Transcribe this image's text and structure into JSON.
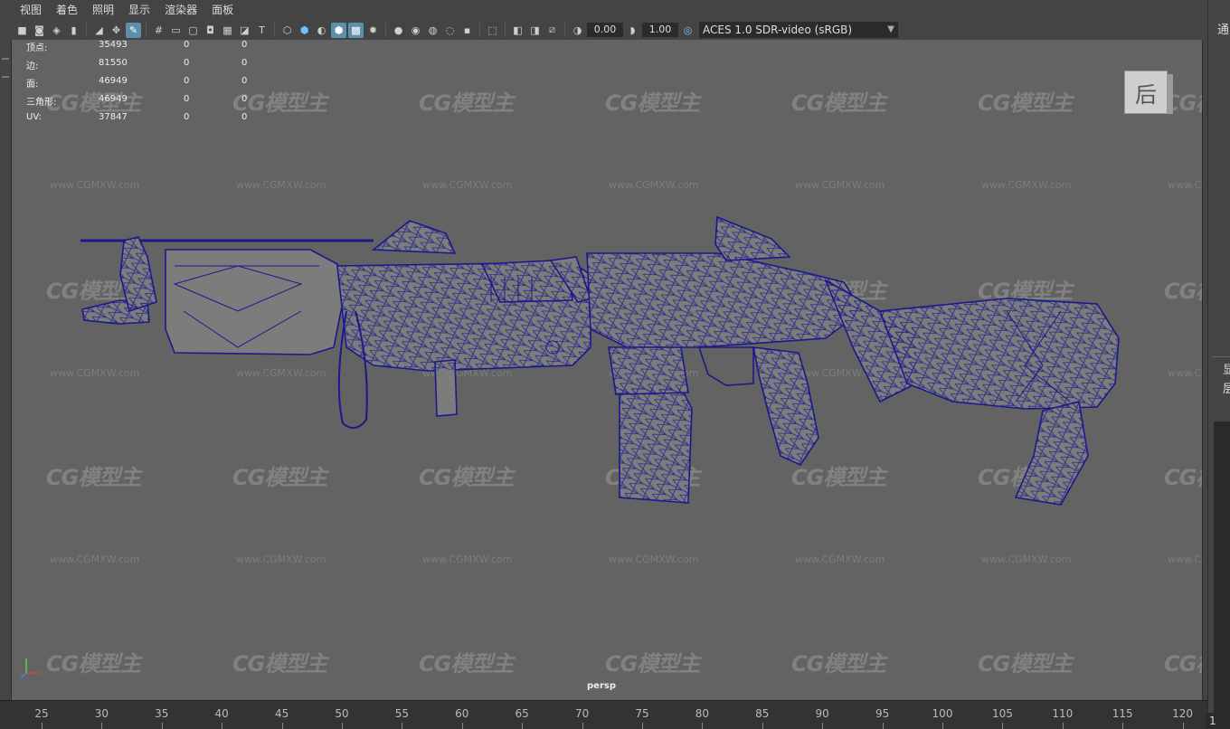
{
  "menubar": {
    "items": [
      "视图",
      "着色",
      "照明",
      "显示",
      "渲染器",
      "面板"
    ]
  },
  "toolbar": {
    "exposure_value": "0.00",
    "gamma_value": "1.00",
    "color_space": "ACES 1.0 SDR-video (sRGB)",
    "icons": [
      "camera-icon",
      "camera-attributes-icon",
      "bookmark-icon",
      "bookmark-flag-icon",
      "image-plane-icon",
      "2d-pan-icon",
      "grease-pencil-icon",
      "grid-icon",
      "film-gate-icon",
      "resolution-gate-icon",
      "gate-mask-icon",
      "field-chart-icon",
      "safe-action-icon",
      "safe-title-icon",
      "wireframe-icon",
      "smooth-shade-icon",
      "default-material-icon",
      "wireframe-on-shaded-icon",
      "textured-icon",
      "lights-icon",
      "shadows-icon",
      "screen-space-ao-icon",
      "motion-blur-icon",
      "anti-aliasing-icon",
      "depth-of-field-icon",
      "isolate-select-icon",
      "xray-icon",
      "xray-joints-icon",
      "xray-components-icon",
      "exposure-icon",
      "gamma-icon",
      "color-management-icon"
    ]
  },
  "hud": {
    "rows": [
      {
        "label": "顶点:",
        "v1": "35493",
        "v2": "0",
        "v3": "0"
      },
      {
        "label": "边:",
        "v1": "81550",
        "v2": "0",
        "v3": "0"
      },
      {
        "label": "面:",
        "v1": "46949",
        "v2": "0",
        "v3": "0"
      },
      {
        "label": "三角形:",
        "v1": "46949",
        "v2": "0",
        "v3": "0"
      },
      {
        "label": "UV:",
        "v1": "37847",
        "v2": "0",
        "v3": "0"
      }
    ]
  },
  "viewcube": {
    "face_label": "后"
  },
  "camera_label": "persp",
  "watermark": {
    "logo": "CG模型主",
    "url": "www.CGMXW.com"
  },
  "right_panel": {
    "top_label": "通",
    "mid_label_1": "显",
    "mid_label_2": "层"
  },
  "timeline": {
    "ticks": [
      "25",
      "30",
      "35",
      "40",
      "45",
      "50",
      "55",
      "60",
      "65",
      "70",
      "75",
      "80",
      "85",
      "90",
      "95",
      "100",
      "105",
      "110",
      "115",
      "120"
    ],
    "current_frame": "1"
  },
  "colors": {
    "viewport_bg": "#636363",
    "wireframe": "#1a1a8c",
    "mesh_fill": "#7c7c7c",
    "active_tool": "#5d8fa8"
  }
}
